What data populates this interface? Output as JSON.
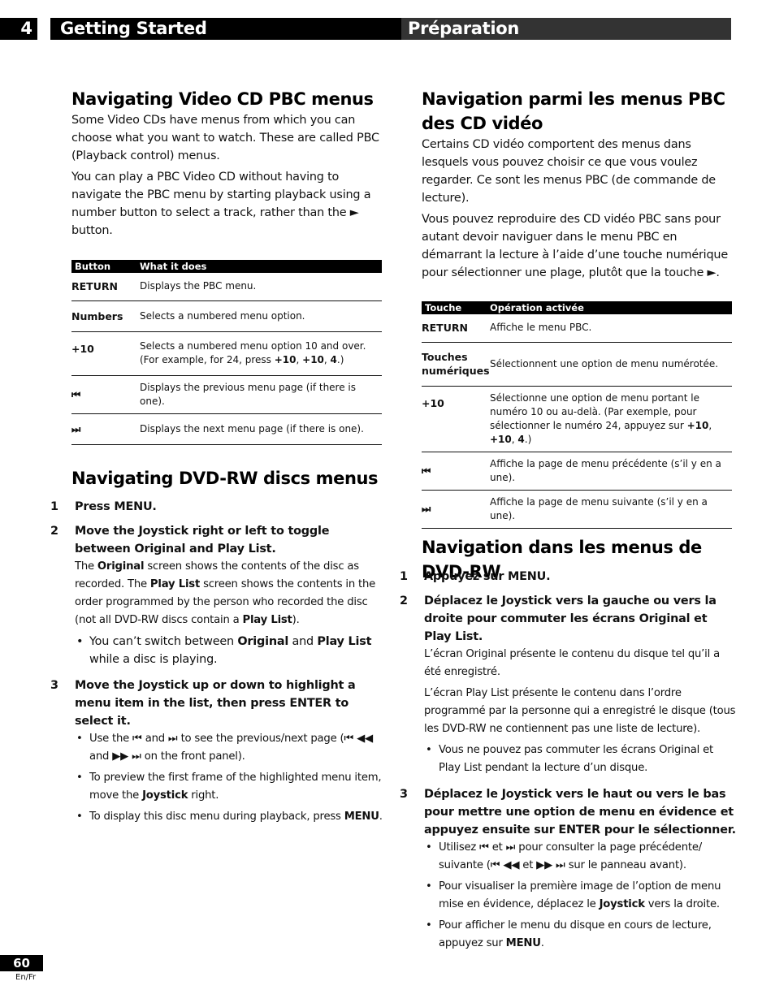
{
  "header": {
    "chapter_number": "4",
    "title_en": "Getting Started",
    "title_fr": "Préparation"
  },
  "en": {
    "pbc": {
      "heading": "Navigating Video CD PBC menus",
      "para1": "Some Video CDs have menus from which you can choose what you want to watch. These are called PBC (Playback control) menus.",
      "para2": "You can play a PBC Video CD without having to navigate the PBC menu by starting playback using a number button to select a track, rather than the ► button.",
      "table": {
        "headers": [
          "Button",
          "What it does"
        ],
        "rows": [
          {
            "key": "RETURN",
            "value": "Displays the PBC menu."
          },
          {
            "key": "Numbers",
            "value": "Selects a numbered menu option."
          },
          {
            "key": "+10",
            "value_pre": "Selects a numbered menu option 10 and over. (For example, for 24, press ",
            "b1": "+10",
            "sep1": ", ",
            "b2": "+10",
            "sep2": ", ",
            "b3": "4",
            "value_post": ".)"
          },
          {
            "key": "⏮",
            "key_icon": "previous-icon",
            "value": "Displays the previous menu page (if there is one)."
          },
          {
            "key": "⏭",
            "key_icon": "next-icon",
            "value": "Displays the next menu page (if there is one)."
          }
        ]
      }
    },
    "dvd": {
      "heading": "Navigating DVD-RW discs menus",
      "steps": [
        {
          "num": "1",
          "title": "Press MENU."
        },
        {
          "num": "2",
          "title": "Move the Joystick right or left  to toggle between Original and Play List.",
          "text": {
            "t1": "The ",
            "b1": "Original",
            "t2": " screen shows the contents of the disc as recorded. The ",
            "b2": "Play List",
            "t3": " screen shows the contents in the order programmed by the person who recorded the disc (not all DVD-RW discs contain a ",
            "b3": "Play List",
            "t4": ")."
          },
          "bullets": [
            {
              "t1": "You can’t switch between ",
              "b1": "Original",
              "t2": " and ",
              "b2": "Play List",
              "t3": " while a disc is playing."
            }
          ]
        },
        {
          "num": "3",
          "title": "Move the Joystick up or down to highlight a menu item in the list, then press ENTER to select it.",
          "bullets": [
            {
              "t1": "Use the ⏮ and ⏭ to see the previous/next page (⏮ ◀◀ and ▶▶ ⏭ on the front panel)."
            },
            {
              "t1": "To preview the first frame of the highlighted menu item, move the ",
              "b1": "Joystick",
              "t2": " right."
            },
            {
              "t1": "To display this disc menu during playback, press ",
              "b1": "MENU",
              "t2": "."
            }
          ]
        }
      ]
    }
  },
  "fr": {
    "pbc": {
      "heading": "Navigation parmi les menus PBC des CD vidéo",
      "para1": "Certains CD vidéo comportent des menus dans lesquels vous pouvez choisir ce que vous voulez regarder. Ce sont les menus PBC (de commande de lecture).",
      "para2": "Vous pouvez reproduire des CD vidéo PBC sans pour autant devoir naviguer dans le menu PBC en démarrant la lecture à l’aide d’une touche numérique pour sélectionner une plage, plutôt que la touche ►.",
      "table": {
        "headers": [
          "Touche",
          "Opération activée"
        ],
        "rows": [
          {
            "key": "RETURN",
            "value": "Affiche le menu PBC."
          },
          {
            "key": "Touches numériques",
            "value": "Sélectionnent une option de menu numérotée."
          },
          {
            "key": "+10",
            "value_pre": "Sélectionne une option de menu portant le numéro 10 ou au-delà. (Par exemple, pour sélectionner le numéro 24, appuyez sur ",
            "b1": "+10",
            "sep1": ", ",
            "b2": "+10",
            "sep2": ", ",
            "b3": "4",
            "value_post": ".)"
          },
          {
            "key": "⏮",
            "key_icon": "previous-icon",
            "value": "Affiche la page de menu précédente (s’il y en a une)."
          },
          {
            "key": "⏭",
            "key_icon": "next-icon",
            "value": "Affiche la page de menu suivante (s’il y en a une)."
          }
        ]
      }
    },
    "dvd": {
      "heading": "Navigation dans les menus de DVD-RW",
      "steps": [
        {
          "num": "1",
          "title": "Appuyez sur MENU."
        },
        {
          "num": "2",
          "title": "Déplacez le Joystick vers la gauche ou vers la droite pour commuter les écrans Original et Play List.",
          "text1": "L’écran Original présente le contenu du disque tel qu’il a été enregistré.",
          "text2": "L’écran Play List présente le contenu dans l’ordre programmé par la personne qui a enregistré le disque (tous les DVD-RW ne contiennent pas une liste de lecture).",
          "bullets": [
            {
              "t1": "Vous ne pouvez pas commuter les écrans Original et Play List pendant la lecture d’un disque."
            }
          ]
        },
        {
          "num": "3",
          "title": "Déplacez le Joystick vers le haut ou vers le bas pour mettre une option de menu en évidence et appuyez ensuite sur ENTER pour le sélectionner.",
          "bullets": [
            {
              "t1": "Utilisez ⏮ et ⏭ pour consulter la page précédente/ suivante (⏮ ◀◀ et ▶▶ ⏭ sur le panneau avant)."
            },
            {
              "t1": "Pour visualiser la première image de l’option de menu mise en évidence, déplacez le ",
              "b1": "Joystick",
              "t2": " vers la droite."
            },
            {
              "t1": "Pour afficher le menu du disque en cours de lecture, appuyez sur ",
              "b1": "MENU",
              "t2": "."
            }
          ]
        }
      ]
    }
  },
  "footer": {
    "page_number": "60",
    "language": "En/Fr"
  }
}
